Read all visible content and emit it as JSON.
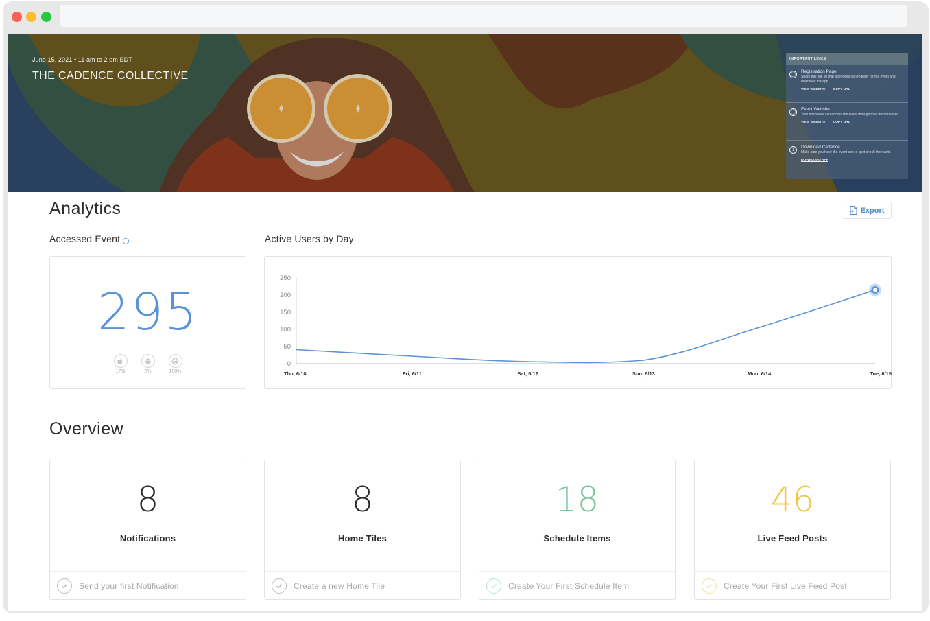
{
  "banner": {
    "event_meta": "June 15, 2021  •  11 am to 2 pm EDT",
    "event_title": "THE CADENCE COLLECTIVE",
    "links_panel": {
      "header": "IMPORTANT LINKS",
      "items": [
        {
          "icon": "globe-icon",
          "title": "Registration Page",
          "description": "Share this link so that attendees can register for the event and download the app.",
          "actions": [
            "VIEW WEBSITE",
            "COPY URL"
          ]
        },
        {
          "icon": "globe-icon",
          "title": "Event Website",
          "description": "Your attendees can access the event through their web browser.",
          "actions": [
            "VIEW WEBSITE",
            "COPY URL"
          ]
        },
        {
          "icon": "download-icon",
          "title": "Download Cadence",
          "description": "Make sure you have the event app to spot check the event.",
          "actions": [
            "DOWNLOAD APP"
          ]
        }
      ]
    }
  },
  "analytics": {
    "title": "Analytics",
    "export_label": "Export",
    "accessed_event": {
      "label": "Accessed Event",
      "value": "295",
      "accent_color": "#5b94d6",
      "platforms": [
        {
          "icon": "apple-icon",
          "percent": "17%"
        },
        {
          "icon": "android-icon",
          "percent": "2%"
        },
        {
          "icon": "web-globe-icon",
          "percent": "100%"
        }
      ]
    },
    "active_users": {
      "label": "Active Users by Day"
    }
  },
  "chart_data": {
    "type": "line",
    "title": "Active Users by Day",
    "xlabel": "",
    "ylabel": "",
    "categories": [
      "Thu, 6/10",
      "Fri, 6/11",
      "Sat, 6/12",
      "Sun, 6/13",
      "Mon, 6/14",
      "Tue, 6/15"
    ],
    "series": [
      {
        "name": "Active Users",
        "values": [
          41,
          22,
          6,
          10,
          106,
          215
        ],
        "color": "#5b94d6"
      }
    ],
    "ylim": [
      0,
      250
    ],
    "yticks": [
      0,
      50,
      100,
      150,
      200,
      250
    ],
    "grid": false,
    "highlighted_point": "Tue, 6/15"
  },
  "overview": {
    "title": "Overview",
    "cards": [
      {
        "value": "8",
        "label": "Notifications",
        "action": "Send your first Notification",
        "color": "#2b2b2b",
        "check_color": "#bdbdbd"
      },
      {
        "value": "8",
        "label": "Home Tiles",
        "action": "Create a new Home Tile",
        "color": "#2b2b2b",
        "check_color": "#bdbdbd"
      },
      {
        "value": "18",
        "label": "Schedule Items",
        "action": "Create Your First Schedule Item",
        "color": "#7cc7a0",
        "check_color": "#b9e1cc"
      },
      {
        "value": "46",
        "label": "Live Feed Posts",
        "action": "Create Your First Live Feed Post",
        "color": "#f4c443",
        "check_color": "#f7dc95"
      }
    ]
  }
}
